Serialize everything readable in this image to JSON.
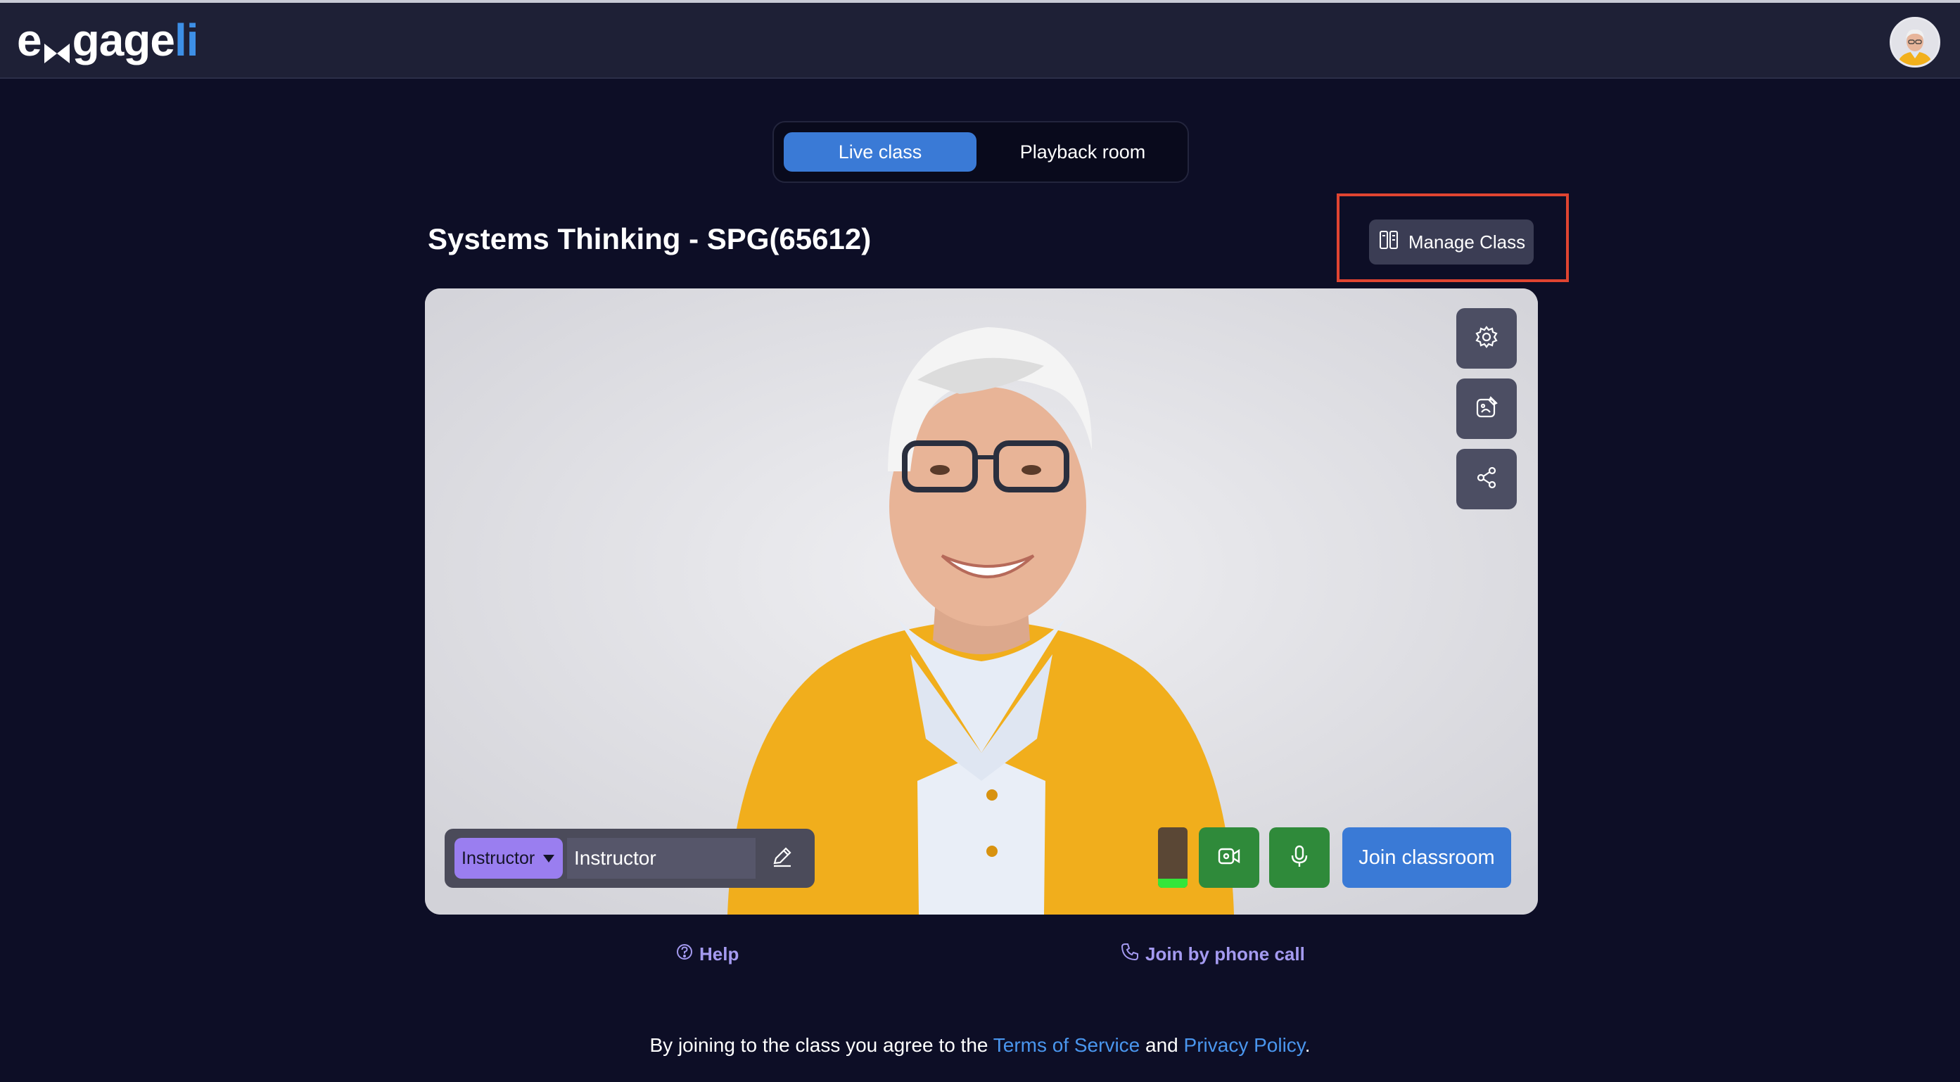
{
  "app": {
    "logo_main": "e",
    "logo_mid": "gage",
    "logo_accent": "li",
    "colors": {
      "background": "#0d0e26",
      "accent": "#3a7ad6",
      "highlight": "#e04431",
      "success": "#2f8a3a",
      "link": "#4a96ee",
      "help": "#a49af0"
    }
  },
  "header": {
    "avatar_icon": "user-avatar"
  },
  "tabs": [
    {
      "label": "Live class",
      "active": true
    },
    {
      "label": "Playback room",
      "active": false
    }
  ],
  "class": {
    "title": "Systems Thinking - SPG(65612)",
    "manage_label": "Manage Class",
    "manage_icon": "manage-class-icon"
  },
  "video": {
    "side_buttons": [
      {
        "icon": "gear-icon"
      },
      {
        "icon": "background-effects-icon"
      },
      {
        "icon": "share-icon"
      }
    ],
    "role": {
      "selected": "Instructor"
    },
    "name": {
      "value": "Instructor"
    },
    "edit_icon": "pencil-icon",
    "audio_level": 0.15,
    "camera_icon": "camera-icon",
    "mic_icon": "microphone-icon",
    "join_label": "Join classroom"
  },
  "links": {
    "help_label": "Help",
    "phone_label": "Join by phone call"
  },
  "footer": {
    "prefix": "By joining to the class you agree to the ",
    "terms": "Terms of Service",
    "and": " and ",
    "privacy": "Privacy Policy",
    "suffix": "."
  }
}
